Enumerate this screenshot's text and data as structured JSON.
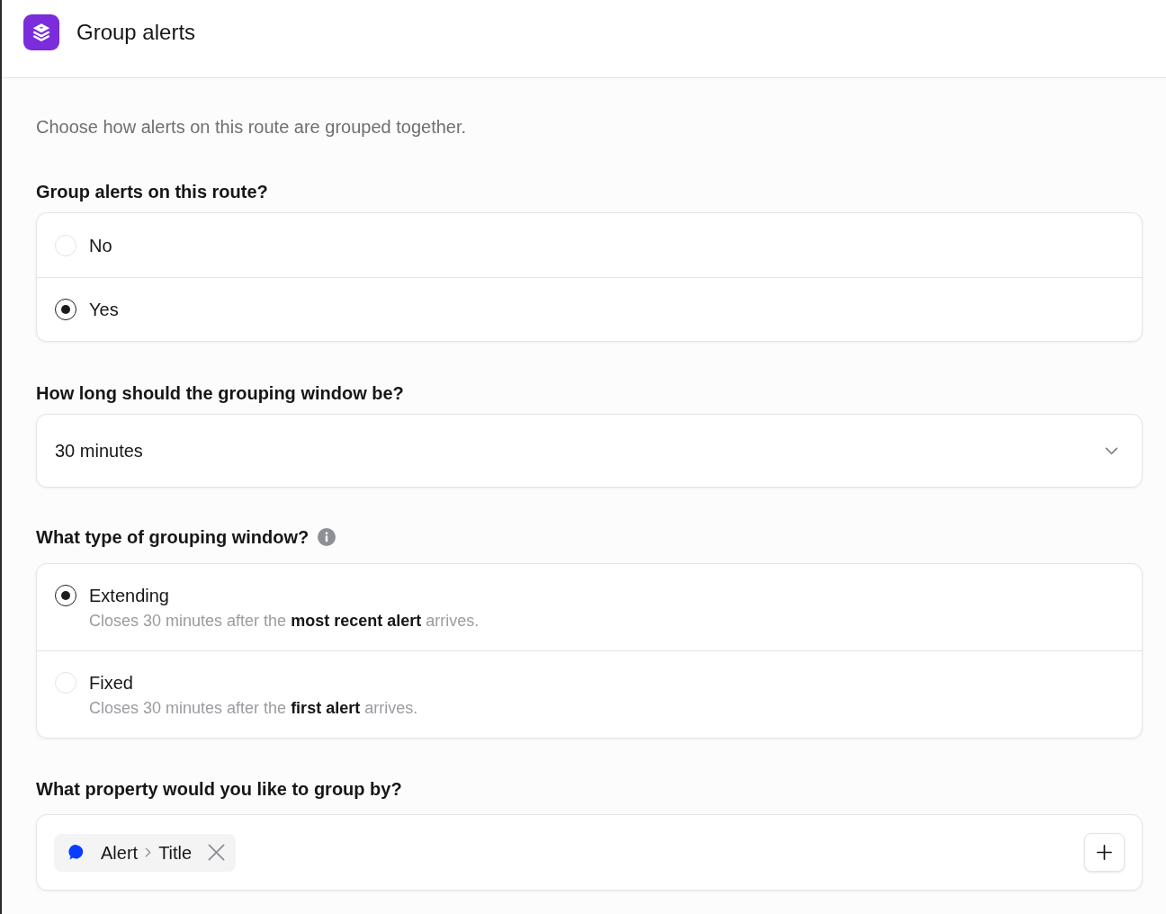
{
  "header": {
    "title": "Group alerts"
  },
  "description": "Choose how alerts on this route are grouped together.",
  "group_alerts": {
    "label": "Group alerts on this route?",
    "options": [
      {
        "label": "No",
        "selected": false
      },
      {
        "label": "Yes",
        "selected": true
      }
    ]
  },
  "window_length": {
    "label": "How long should the grouping window be?",
    "value": "30 minutes"
  },
  "window_type": {
    "label": "What type of grouping window?",
    "options": [
      {
        "label": "Extending",
        "description": "Closes 30 minutes after the **most recent alert** arrives.",
        "selected": true
      },
      {
        "label": "Fixed",
        "description": "Closes 30 minutes after the **first alert** arrives.",
        "selected": false
      }
    ]
  },
  "group_by": {
    "label": "What property would you like to group by?",
    "chips": [
      {
        "path": [
          "Alert",
          "Title"
        ]
      }
    ]
  }
}
